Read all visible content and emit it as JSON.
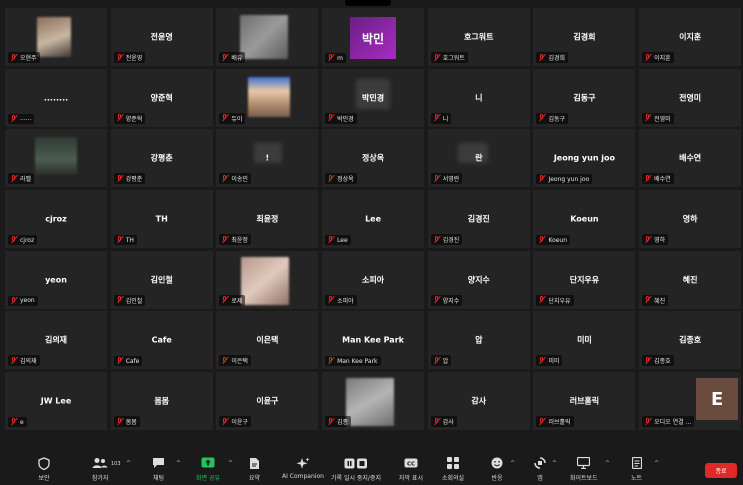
{
  "tiles": [
    {
      "center": "",
      "label": "오현주"
    },
    {
      "center": "전윤영",
      "label": "전윤영"
    },
    {
      "center": "",
      "label": "배유"
    },
    {
      "center": "",
      "label": "m"
    },
    {
      "center": "호그워트",
      "label": "호그워트"
    },
    {
      "center": "김경희",
      "label": "김경희"
    },
    {
      "center": "이지훈",
      "label": "이지훈"
    },
    {
      "center": "........",
      "label": "......"
    },
    {
      "center": "양준혁",
      "label": "양준혁"
    },
    {
      "center": "",
      "label": "듀이"
    },
    {
      "center": "박민경",
      "label": "박민경"
    },
    {
      "center": "니",
      "label": "니"
    },
    {
      "center": "김동구",
      "label": "김동구"
    },
    {
      "center": "전영미",
      "label": "전영미"
    },
    {
      "center": "",
      "label": "라벨"
    },
    {
      "center": "강평춘",
      "label": "강평춘"
    },
    {
      "center": "!",
      "label": "이송민"
    },
    {
      "center": "정상옥",
      "label": "정상옥"
    },
    {
      "center": "란",
      "label": "서영란"
    },
    {
      "center": "Jeong yun joo",
      "label": "Jeong yun joo"
    },
    {
      "center": "배수연",
      "label": "배수연"
    },
    {
      "center": "cjroz",
      "label": "cjroz"
    },
    {
      "center": "TH",
      "label": "TH"
    },
    {
      "center": "최윤정",
      "label": "최윤정"
    },
    {
      "center": "Lee",
      "label": "Lee"
    },
    {
      "center": "김경진",
      "label": "김경진"
    },
    {
      "center": "Koeun",
      "label": "Koeun"
    },
    {
      "center": "영하",
      "label": "영하"
    },
    {
      "center": "yeon",
      "label": "yeon"
    },
    {
      "center": "김인철",
      "label": "김인철"
    },
    {
      "center": "",
      "label": "로제"
    },
    {
      "center": "소피아",
      "label": "소피아"
    },
    {
      "center": "양지수",
      "label": "양지수"
    },
    {
      "center": "단지우유",
      "label": "단지우유"
    },
    {
      "center": "혜진",
      "label": "혜진"
    },
    {
      "center": "김의재",
      "label": "김의재"
    },
    {
      "center": "Cafe",
      "label": "Cafe"
    },
    {
      "center": "이은택",
      "label": "이은택"
    },
    {
      "center": "Man Kee Park",
      "label": "Man Kee Park"
    },
    {
      "center": "압",
      "label": "압"
    },
    {
      "center": "미미",
      "label": "미미"
    },
    {
      "center": "김종호",
      "label": "김종호"
    },
    {
      "center": "JW Lee",
      "label": "e"
    },
    {
      "center": "봄봄",
      "label": "봄봄"
    },
    {
      "center": "이윤구",
      "label": "이윤구"
    },
    {
      "center": "",
      "label": "김종"
    },
    {
      "center": "감사",
      "label": "감사"
    },
    {
      "center": "러브홀릭",
      "label": "러브홀릭"
    },
    {
      "center": "",
      "label": "오디오 연결 ..."
    }
  ],
  "avatars": {
    "min_letter": "박민",
    "e_letter": "E"
  },
  "toolbar": {
    "security": "보안",
    "participants": "참가자",
    "participants_count": "103",
    "chat": "채팅",
    "share": "화면 공유",
    "summary": "요약",
    "ai": "AI Companion",
    "record": "기록 일시 중지/중지",
    "captions": "자막 표시",
    "breakout": "소회의실",
    "reactions": "반응",
    "apps": "앱",
    "whiteboard": "화이트보드",
    "notes": "노트",
    "end": "종료"
  },
  "colors": {
    "share_green": "#22c55e",
    "end_red": "#e02828",
    "muted_red": "#e02828",
    "min_purple": "#9b27b0",
    "e_brown": "#6b4a3e"
  }
}
